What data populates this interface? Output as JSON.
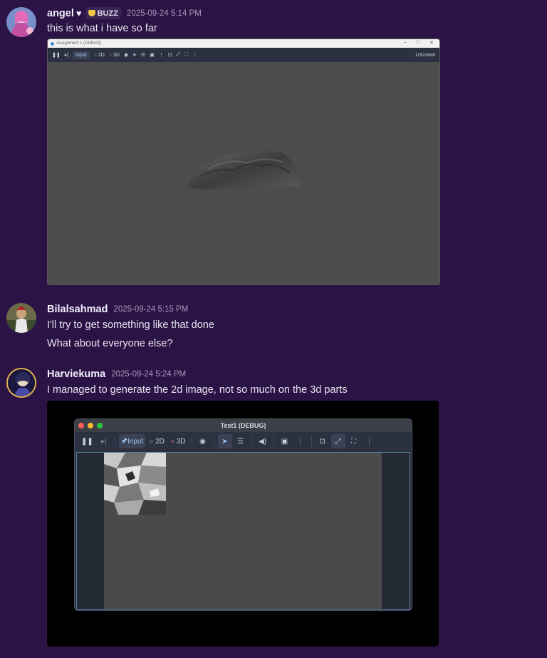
{
  "messages": [
    {
      "username": "angel",
      "heart": "♥",
      "tag": "BUZZ",
      "timestamp": "2025-09-24 5:14 PM",
      "lines": [
        "this is what i have so far"
      ],
      "attachment": {
        "window_title": "Assignment 1 (DEBUG)",
        "toolbar": {
          "input": "Input",
          "twod": "2D",
          "threed": "3D"
        },
        "resolution": "1152x648"
      }
    },
    {
      "username": "Bilalsahmad",
      "timestamp": "2025-09-24 5:15 PM",
      "lines": [
        "I'll try to get something like that done",
        "What about everyone else?"
      ]
    },
    {
      "username": "Harviekuma",
      "timestamp": "2025-09-24 5:24 PM",
      "lines": [
        "I managed to generate the 2d image, not so much on the 3d parts"
      ],
      "attachment": {
        "window_title": "Test1 (DEBUG)",
        "toolbar": {
          "input": "Input",
          "twod": "2D",
          "threed": "3D"
        }
      }
    }
  ],
  "colors": {
    "background": "#2b1346",
    "tag_icon": "#f2c744",
    "close_dot": "#fe5f57",
    "min_dot": "#febc2e",
    "max_dot": "#28c840"
  }
}
